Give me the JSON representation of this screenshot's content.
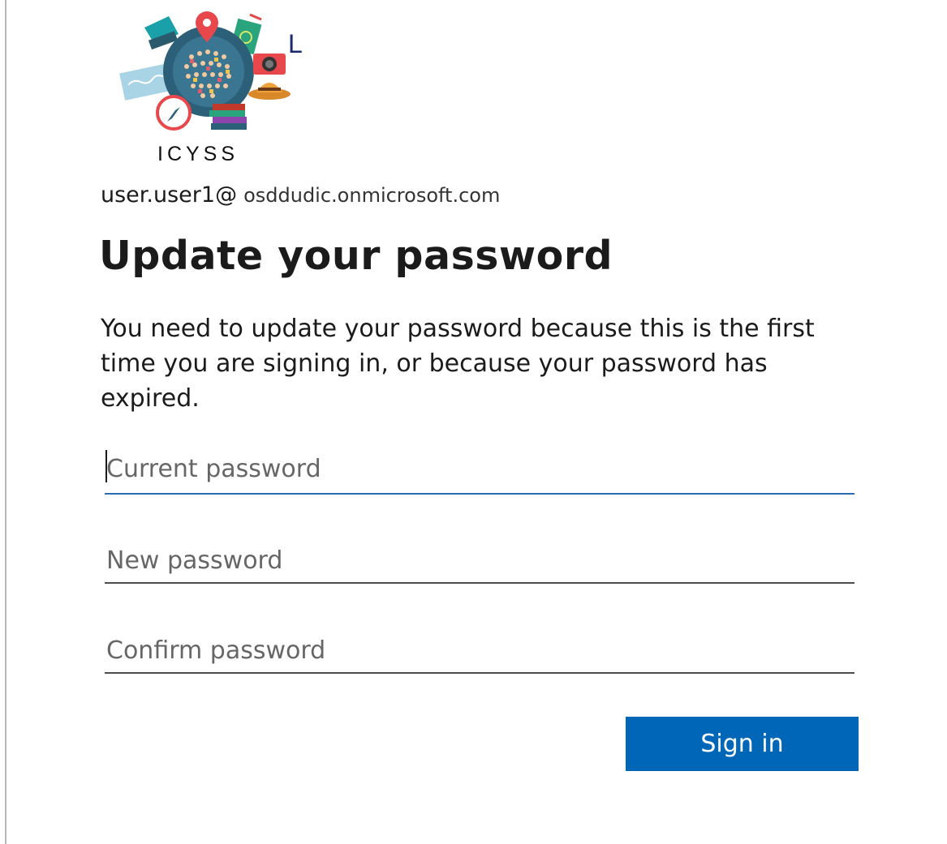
{
  "logo": {
    "caption": "ICYSS",
    "letter_fragment": "L",
    "icon": "travel-globe-logo"
  },
  "account": {
    "user": "user.user1@",
    "domain": "osddudic.onmicrosoft.com"
  },
  "title": "Update your password",
  "description": "You need to update your password because this is the first time you are signing in, or because your password has expired.",
  "fields": {
    "current_placeholder": "Current password",
    "new_placeholder": "New password",
    "confirm_placeholder": "Confirm password"
  },
  "actions": {
    "sign_in_label": "Sign in"
  },
  "colors": {
    "accent": "#0067b8",
    "focus_underline": "#2b6cb0",
    "text": "#1b1b1b"
  }
}
